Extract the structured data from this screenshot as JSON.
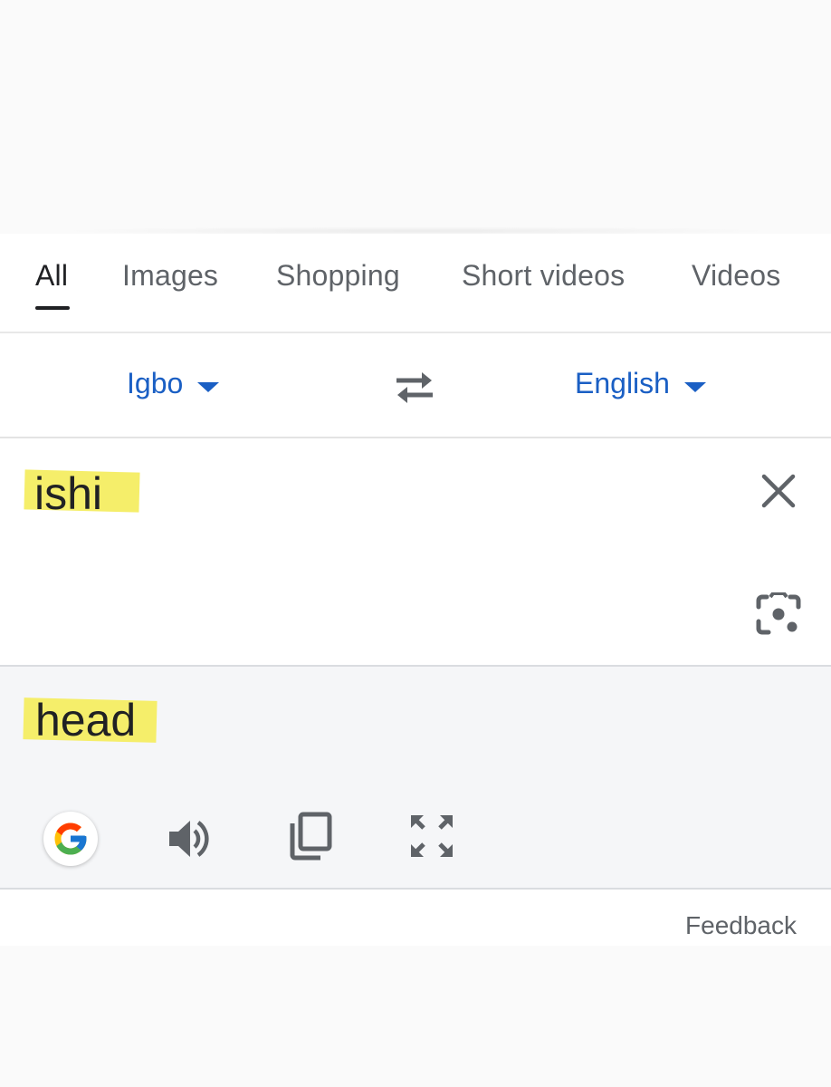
{
  "tabs": [
    {
      "label": "All",
      "active": true
    },
    {
      "label": "Images",
      "active": false
    },
    {
      "label": "Shopping",
      "active": false
    },
    {
      "label": "Short videos",
      "active": false
    },
    {
      "label": "Videos",
      "active": false
    }
  ],
  "translator": {
    "source_language": "Igbo",
    "target_language": "English",
    "source_text": "ishi",
    "translated_text": "head",
    "icons": {
      "swap": "swap-languages-icon",
      "clear": "close-icon",
      "camera": "camera-lens-icon",
      "google": "google-logo-icon",
      "listen": "speaker-icon",
      "copy": "copy-icon",
      "fullscreen": "fullscreen-icon"
    }
  },
  "feedback_label": "Feedback",
  "colors": {
    "language_link": "#1a5fc4",
    "highlight": "#f5ee6a",
    "target_background": "#f5f6f8"
  }
}
